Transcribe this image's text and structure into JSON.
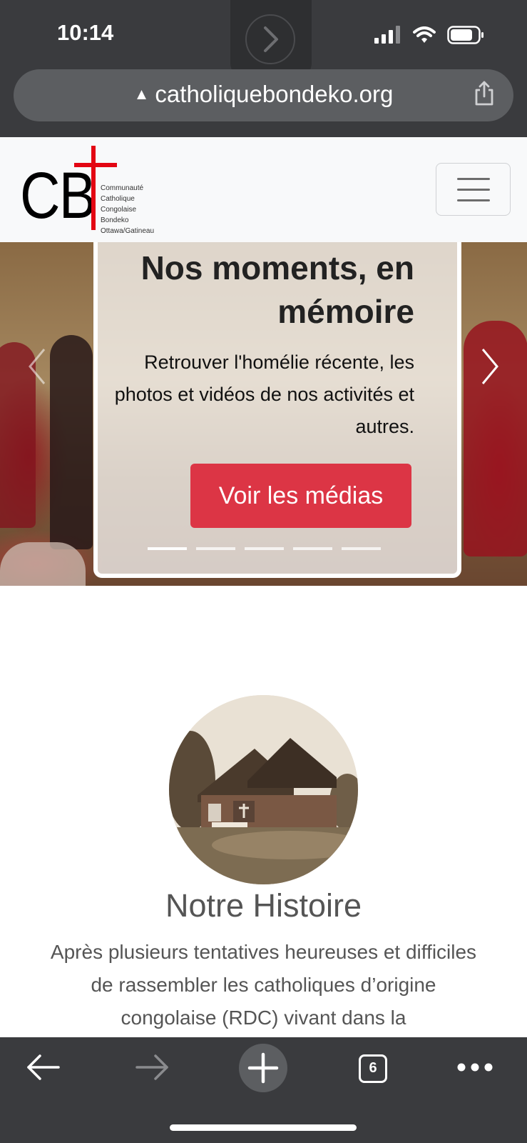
{
  "status_bar": {
    "time": "10:14"
  },
  "browser": {
    "url": "catholiquebondeko.org",
    "security_icon": "warning-triangle-icon",
    "share_icon": "share-icon",
    "tab_count": "6"
  },
  "site": {
    "logo": {
      "letters": "CB",
      "lines": [
        "Communauté",
        "Catholique",
        "Congolaise",
        "Bondeko",
        "Ottawa/Gatineau"
      ],
      "accent_color": "#e30613"
    },
    "menu_icon": "hamburger-icon"
  },
  "carousel": {
    "title": "Nos moments, en mémoire",
    "text": "Retrouver l'homélie récente, les photos et vidéos de nos activités et autres.",
    "button_label": "Voir les médias",
    "button_color": "#dc3545",
    "slide_count": 5,
    "active_slide": 1
  },
  "history": {
    "title": "Notre Histoire",
    "text": "Après plusieurs tentatives heureuses et difficiles de rassembler les catholiques d’origine congolaise (RDC) vivant dans la"
  },
  "toolbar": {
    "back_icon": "back-arrow-icon",
    "forward_icon": "forward-arrow-icon",
    "new_tab_icon": "plus-icon",
    "tabs_icon": "tabs-icon",
    "more_icon": "more-dots-icon"
  }
}
